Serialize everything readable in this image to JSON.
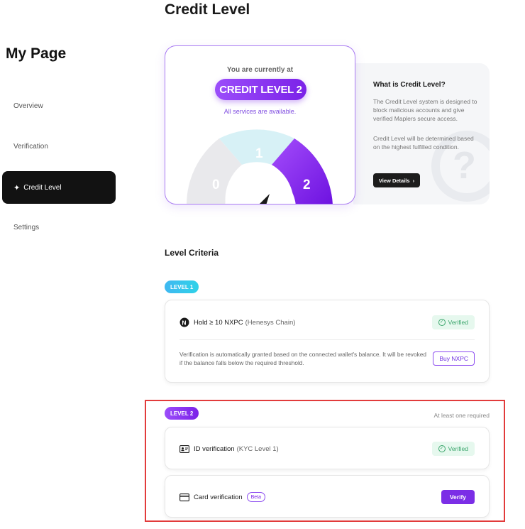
{
  "sidebar": {
    "title": "My Page",
    "items": [
      {
        "label": "Overview"
      },
      {
        "label": "Verification"
      },
      {
        "label": "Credit Level"
      },
      {
        "label": "Settings"
      }
    ],
    "active_index": 2
  },
  "header": {
    "title": "Credit Level"
  },
  "level_card": {
    "currently_text": "You are currently at",
    "level_pill": "CREDIT LEVEL 2",
    "availability": "All services are available.",
    "gauge_labels": [
      "0",
      "1",
      "2"
    ],
    "current_level": 2
  },
  "info_panel": {
    "title": "What is Credit Level?",
    "para1": "The Credit Level system is designed to block malicious accounts and give verified Maplers secure access.",
    "para2": "Credit Level will be determined based on the highest fulfilled condition.",
    "button": "View Details",
    "button_icon": "chevron-right-icon"
  },
  "criteria": {
    "title": "Level Criteria",
    "level1": {
      "badge": "LEVEL 1",
      "item_label": "Hold ≥ 10 NXPC",
      "item_sub": "(Henesys Chain)",
      "item_icon": "nxpc-token-icon",
      "status": "Verified",
      "description": "Verification is automatically granted based on the connected wallet's balance. It will be revoked if the balance falls below the required threshold.",
      "action": "Buy NXPC"
    },
    "level2": {
      "badge": "LEVEL 2",
      "requirement": "At least one required",
      "items": [
        {
          "label": "ID verification",
          "sub": "(KYC Level 1)",
          "icon": "id-card-icon",
          "status": "Verified"
        },
        {
          "label": "Card verification",
          "tag": "Beta",
          "icon": "credit-card-icon",
          "action": "Verify"
        }
      ]
    }
  },
  "colors": {
    "accent_purple": "#7b22e8",
    "level1_cyan": "#2fd2e8",
    "verified_green": "#3aa56b",
    "highlight_red": "#e23b3b",
    "active_nav_bg": "#121212"
  }
}
